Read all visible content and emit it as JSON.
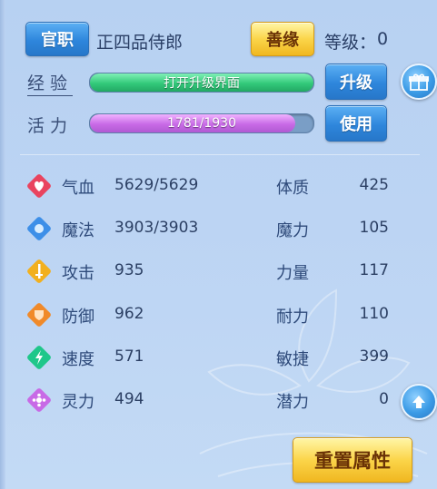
{
  "header": {
    "title_button": "官职",
    "title_value": "正四品侍郎",
    "karma_button": "善缘",
    "level_label": "等级：",
    "level_value": "0"
  },
  "experience": {
    "label": "经验",
    "bar_text": "打开升级界面",
    "fill_fraction": 1.0,
    "upgrade_button": "升级"
  },
  "vitality": {
    "label": "活力",
    "bar_text": "1781/1930",
    "fill_fraction": 0.92,
    "use_button": "使用"
  },
  "stats": [
    {
      "name": "气血",
      "value": "5629/5629",
      "icon": "heart-icon",
      "color": "#e9445f"
    },
    {
      "name": "魔法",
      "value": "3903/3903",
      "icon": "mana-icon",
      "color": "#3d8fe8"
    },
    {
      "name": "攻击",
      "value": "935",
      "icon": "sword-icon",
      "color": "#f2b01e"
    },
    {
      "name": "防御",
      "value": "962",
      "icon": "shield-icon",
      "color": "#f08a2a"
    },
    {
      "name": "速度",
      "value": "571",
      "icon": "lightning-icon",
      "color": "#1fc78a"
    },
    {
      "name": "灵力",
      "value": "494",
      "icon": "spirit-icon",
      "color": "#c86ae6"
    }
  ],
  "attributes": [
    {
      "name": "体质",
      "value": "425"
    },
    {
      "name": "魔力",
      "value": "105"
    },
    {
      "name": "力量",
      "value": "117"
    },
    {
      "name": "耐力",
      "value": "110"
    },
    {
      "name": "敏捷",
      "value": "399"
    },
    {
      "name": "潜力",
      "value": "0"
    }
  ],
  "reset_button": "重置属性",
  "gift_icon": "gift-icon",
  "scroll_up_icon": "arrow-up-icon"
}
